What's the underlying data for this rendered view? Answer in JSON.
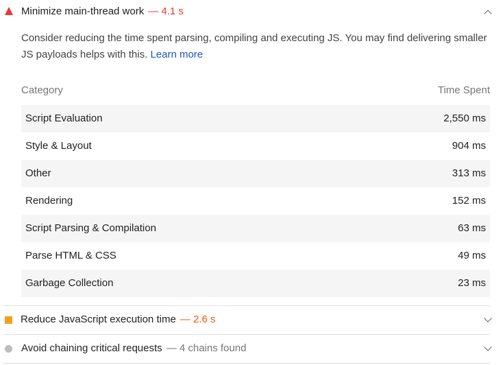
{
  "audits": [
    {
      "title": "Minimize main-thread work",
      "value": "— 4.1 s",
      "value_color": "#e53935",
      "status": "fail",
      "icon": "warning-triangle-icon",
      "expanded": true,
      "description": "Consider reducing the time spent parsing, compiling and executing JS. You may find delivering smaller JS payloads helps with this.",
      "learn_more": "Learn more",
      "table": {
        "headers": [
          "Category",
          "Time Spent"
        ],
        "rows": [
          {
            "category": "Script Evaluation",
            "time": "2,550 ms"
          },
          {
            "category": "Style & Layout",
            "time": "904 ms"
          },
          {
            "category": "Other",
            "time": "313 ms"
          },
          {
            "category": "Rendering",
            "time": "152 ms"
          },
          {
            "category": "Script Parsing & Compilation",
            "time": "63 ms"
          },
          {
            "category": "Parse HTML & CSS",
            "time": "49 ms"
          },
          {
            "category": "Garbage Collection",
            "time": "23 ms"
          }
        ]
      }
    },
    {
      "title": "Reduce JavaScript execution time",
      "value": "— 2.6 s",
      "value_color": "#e8590c",
      "status": "average",
      "icon": "orange-square-icon",
      "expanded": false
    },
    {
      "title": "Avoid chaining critical requests",
      "value": "— 4 chains found",
      "value_color": "#757575",
      "status": "informative",
      "icon": "gray-circle-icon",
      "expanded": false
    }
  ],
  "colors": {
    "fail": "#e53935",
    "average": "#f4a01c",
    "informative": "#bdbdbd",
    "link": "#1a56c4",
    "row_stripe": "#f5f5f5"
  }
}
